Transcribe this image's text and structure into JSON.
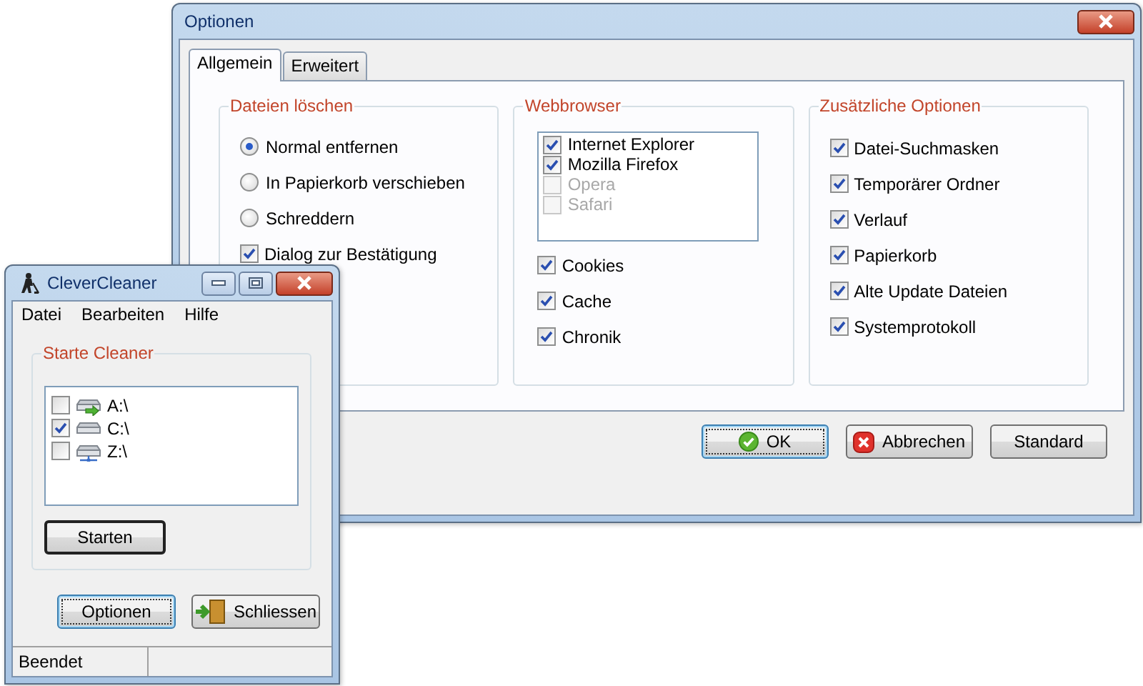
{
  "options_window": {
    "title": "Optionen",
    "tabs": [
      {
        "label": "Allgemein",
        "selected": true
      },
      {
        "label": "Erweitert",
        "selected": false
      }
    ],
    "groups": [
      {
        "title": "Dateien löschen",
        "items": [
          {
            "kind": "radio",
            "label": "Normal entfernen",
            "selected": true
          },
          {
            "kind": "radio",
            "label": "In Papierkorb verschieben",
            "selected": false
          },
          {
            "kind": "radio",
            "label": "Schreddern",
            "selected": false
          },
          {
            "kind": "checkbox",
            "label": "Dialog zur Bestätigung",
            "checked": true
          }
        ]
      },
      {
        "title": "Webbrowser",
        "list": [
          {
            "label": "Internet Explorer",
            "checked": true,
            "disabled": false
          },
          {
            "label": "Mozilla Firefox",
            "checked": true,
            "disabled": false
          },
          {
            "label": "Opera",
            "checked": false,
            "disabled": true
          },
          {
            "label": "Safari",
            "checked": false,
            "disabled": true
          }
        ],
        "items": [
          {
            "kind": "checkbox",
            "label": "Cookies",
            "checked": true
          },
          {
            "kind": "checkbox",
            "label": "Cache",
            "checked": true
          },
          {
            "kind": "checkbox",
            "label": "Chronik",
            "checked": true
          }
        ]
      },
      {
        "title": "Zusätzliche Optionen",
        "items": [
          {
            "kind": "checkbox",
            "label": "Datei-Suchmasken",
            "checked": true
          },
          {
            "kind": "checkbox",
            "label": "Temporärer Ordner",
            "checked": true
          },
          {
            "kind": "checkbox",
            "label": "Verlauf",
            "checked": true
          },
          {
            "kind": "checkbox",
            "label": "Papierkorb",
            "checked": true
          },
          {
            "kind": "checkbox",
            "label": "Alte Update Dateien",
            "checked": true
          },
          {
            "kind": "checkbox",
            "label": "Systemprotokoll",
            "checked": true
          }
        ]
      }
    ],
    "buttons": [
      {
        "kind": "ok",
        "label": "OK",
        "focused": true
      },
      {
        "kind": "cancel",
        "label": "Abbrechen",
        "focused": false
      },
      {
        "kind": "plain",
        "label": "Standard",
        "focused": false
      }
    ]
  },
  "cleaner_window": {
    "title": "CleverCleaner",
    "menu": [
      "Datei",
      "Bearbeiten",
      "Hilfe"
    ],
    "group_title": "Starte Cleaner",
    "drives": [
      {
        "kind": "removable",
        "label": "A:\\",
        "checked": false
      },
      {
        "kind": "local",
        "label": "C:\\",
        "checked": true
      },
      {
        "kind": "network",
        "label": "Z:\\",
        "checked": false
      }
    ],
    "start_button": {
      "label": "Starten",
      "focused": false,
      "default": true
    },
    "buttons": [
      {
        "kind": "plain",
        "label": "Optionen",
        "focused": true
      },
      {
        "kind": "exit",
        "label": "Schliessen",
        "focused": false
      }
    ],
    "status_bar": [
      "Beendet"
    ]
  }
}
